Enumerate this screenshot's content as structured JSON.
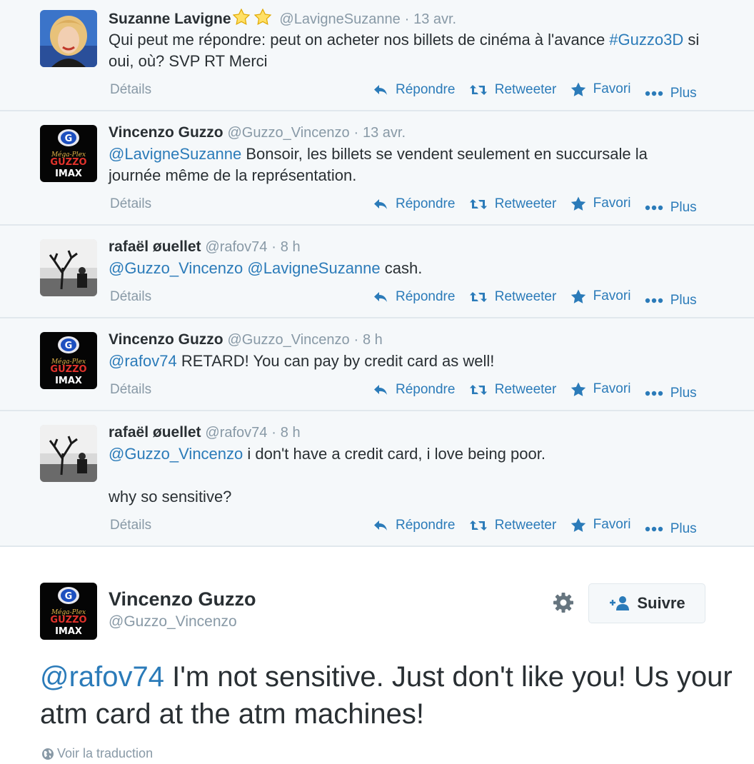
{
  "tweets": [
    {
      "name": "Suzanne Lavigne",
      "handle": "@LavigneSuzanne",
      "sep": "·",
      "time": "13 avr.",
      "text_parts": [
        {
          "t": "Qui peut me répondre: peut on acheter nos billets de cinéma à l'avance ",
          "link": false
        },
        {
          "t": "#Guzzo3D",
          "link": true
        },
        {
          "t": " si oui, où? SVP RT Merci",
          "link": false
        }
      ]
    },
    {
      "name": "Vincenzo Guzzo",
      "handle": "@Guzzo_Vincenzo",
      "sep": "·",
      "time": "13 avr.",
      "text_parts": [
        {
          "t": "@LavigneSuzanne",
          "link": true
        },
        {
          "t": " Bonsoir, les billets se vendent seulement en succursale la journée même de la représentation.",
          "link": false
        }
      ]
    },
    {
      "name": "rafaël øuellet",
      "handle": "@rafov74",
      "sep": "·",
      "time": "8 h",
      "text_parts": [
        {
          "t": "@Guzzo_Vincenzo",
          "link": true
        },
        {
          "t": " ",
          "link": false
        },
        {
          "t": "@LavigneSuzanne",
          "link": true
        },
        {
          "t": " cash.",
          "link": false
        }
      ]
    },
    {
      "name": "Vincenzo Guzzo",
      "handle": "@Guzzo_Vincenzo",
      "sep": "·",
      "time": "8 h",
      "text_parts": [
        {
          "t": "@rafov74",
          "link": true
        },
        {
          "t": " RETARD! You can pay by credit card as well!",
          "link": false
        }
      ]
    },
    {
      "name": "rafaël øuellet",
      "handle": "@rafov74",
      "sep": "·",
      "time": "8 h",
      "text_parts": [
        {
          "t": "@Guzzo_Vincenzo",
          "link": true
        },
        {
          "t": " i don't have a credit card, i love being poor.",
          "link": false
        }
      ],
      "text_line2": "why so sensitive?"
    }
  ],
  "actions": {
    "details": "Détails",
    "reply": "Répondre",
    "retweet": "Retweeter",
    "favorite": "Favori",
    "more": "Plus"
  },
  "main_tweet": {
    "name": "Vincenzo Guzzo",
    "handle": "@Guzzo_Vincenzo",
    "follow_label": "Suivre",
    "mention": "@rafov74",
    "text": " I'm not sensitive. Just don't like you! Us your atm card at the atm machines!",
    "translate": "Voir la traduction"
  },
  "avatar_text": {
    "brand_line1": "Méga-Plex",
    "brand_line2": "GUZZO",
    "brand_line3": "IMAX"
  },
  "colors": {
    "link": "#2b7bb9",
    "muted": "#8899a6",
    "text": "#292f33",
    "background_conversation": "#f5f8fa"
  }
}
